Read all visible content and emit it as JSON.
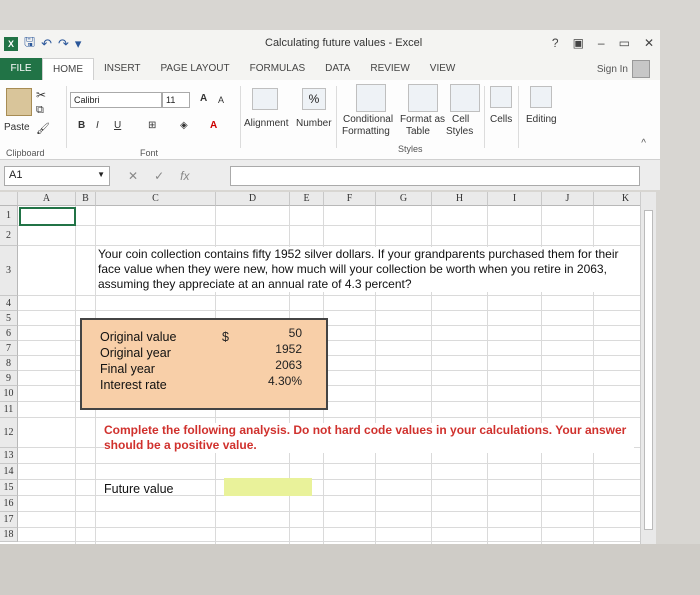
{
  "window": {
    "title": "Calculating future values - Excel",
    "controls": [
      "?",
      "▣",
      "–",
      "▭",
      "✕"
    ]
  },
  "tabs": [
    {
      "label": "FILE"
    },
    {
      "label": "HOME"
    },
    {
      "label": "INSERT"
    },
    {
      "label": "PAGE LAYOUT"
    },
    {
      "label": "FORMULAS"
    },
    {
      "label": "DATA"
    },
    {
      "label": "REVIEW"
    },
    {
      "label": "VIEW"
    }
  ],
  "signin": "Sign In",
  "ribbon": {
    "paste": "Paste",
    "clipboard": "Clipboard",
    "font_name": "Calibri",
    "font_size": "11",
    "bold": "B",
    "italic": "I",
    "underline": "U",
    "grow": "A",
    "shrink": "A",
    "font_group": "Font",
    "alignment": "Alignment",
    "number": "Number",
    "percent": "%",
    "conditional": "Conditional",
    "formatting": "Formatting",
    "format_as": "Format as",
    "table": "Table",
    "cell": "Cell",
    "cell_styles": "Styles",
    "styles_group": "Styles",
    "cells": "Cells",
    "editing": "Editing"
  },
  "formula_bar": {
    "name_box": "A1",
    "fx": "fx",
    "value": ""
  },
  "columns": [
    "A",
    "B",
    "C",
    "D",
    "E",
    "F",
    "G",
    "H",
    "I",
    "J",
    "K"
  ],
  "rows": [
    "1",
    "2",
    "3",
    "4",
    "5",
    "6",
    "7",
    "8",
    "9",
    "10",
    "11",
    "12",
    "13",
    "14",
    "15",
    "16",
    "17",
    "18"
  ],
  "sheet": {
    "problem": "Your coin collection contains fifty 1952 silver dollars. If your grandparents purchased them for their face value when they were new, how much will your collection be worth when you retire in 2063, assuming they appreciate at an annual rate of 4.3 percent?",
    "inputs": [
      {
        "label": "Original value",
        "value": "50"
      },
      {
        "label": "Original year",
        "value": "1952"
      },
      {
        "label": "Final year",
        "value": "2063"
      },
      {
        "label": "Interest rate",
        "value": "4.30%"
      }
    ],
    "currency": "$",
    "instructions": "Complete the following analysis. Do not hard code values in your calculations. Your answer should be a positive value.",
    "future_value_label": "Future value",
    "future_value": ""
  },
  "colors": {
    "excel_green": "#217346",
    "input_fill": "#f8cfa8",
    "answer_fill": "#e9f29a",
    "instruction_red": "#d0312d"
  }
}
